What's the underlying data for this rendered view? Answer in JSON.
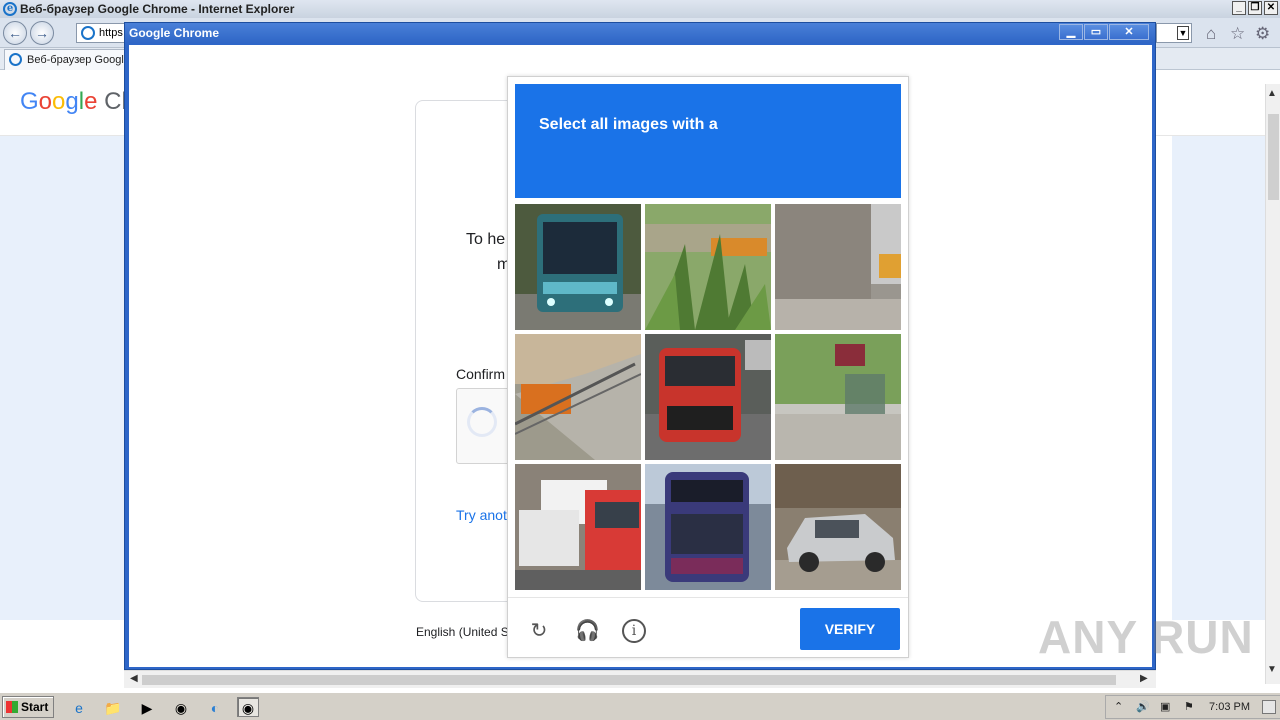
{
  "ie": {
    "title": "Веб-браузер Google Chrome - Internet Explorer",
    "address_prefix": "https",
    "tab_label": "Веб-браузер Google",
    "page_logo": "Google Ch"
  },
  "chrome_window": {
    "title": "Google Chrome"
  },
  "page": {
    "text_line1": "To he",
    "text_line2": "m",
    "confirm_label": "Confirm",
    "try_another": "Try anot",
    "language": "English (United S"
  },
  "captcha": {
    "prompt": "Select all images with a",
    "verify_label": "VERIFY",
    "tiles": [
      "bus",
      "plant",
      "wall",
      "fence",
      "van",
      "street",
      "truck",
      "bus",
      "car"
    ]
  },
  "taskbar": {
    "start_label": "Start",
    "clock": "7:03 PM"
  },
  "watermark": "ANY RUN"
}
